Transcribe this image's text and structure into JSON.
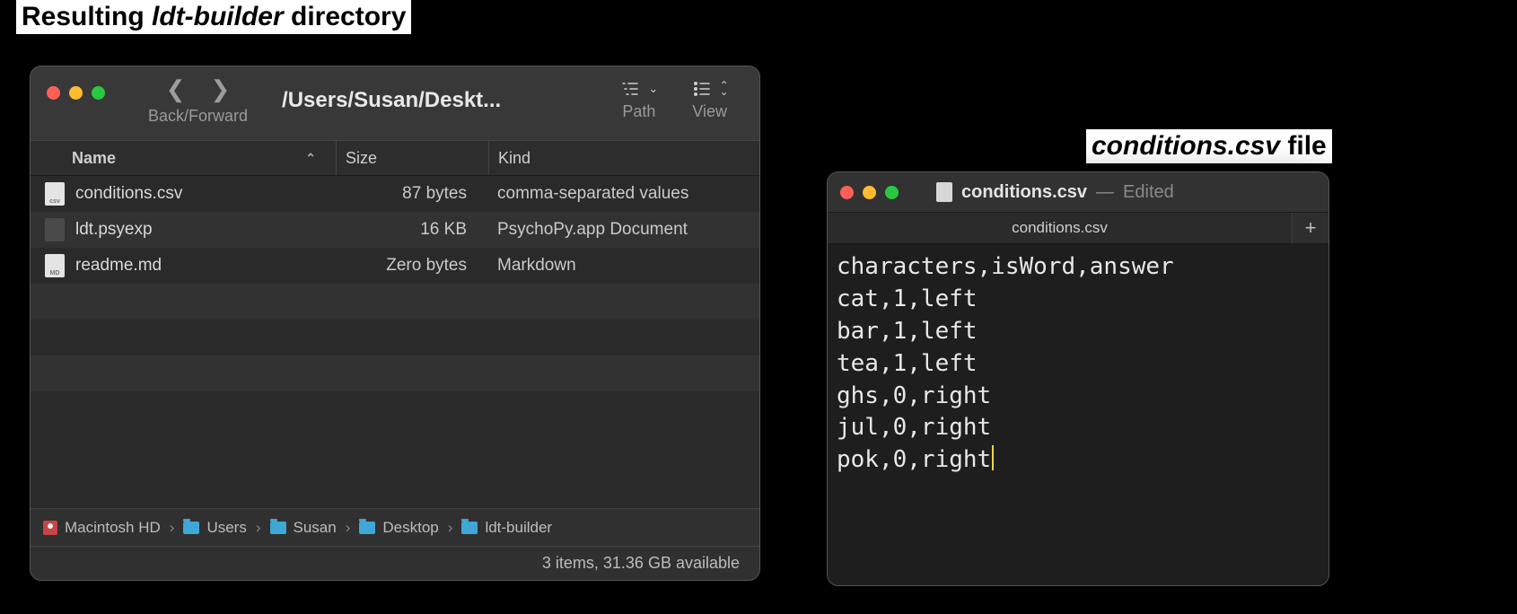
{
  "captions": {
    "left_pre": "Resulting ",
    "left_em": "ldt-builder",
    "left_post": " directory",
    "right_em": "conditions.csv",
    "right_post": " file"
  },
  "finder": {
    "navlabel": "Back/Forward",
    "title": "/Users/Susan/Deskt...",
    "toolbar": {
      "path": "Path",
      "view": "View"
    },
    "columns": {
      "name": "Name",
      "size": "Size",
      "kind": "Kind"
    },
    "rows": [
      {
        "name": "conditions.csv",
        "size": "87 bytes",
        "kind": "comma-separated values",
        "iconsub": "csv",
        "iconClass": ""
      },
      {
        "name": "ldt.psyexp",
        "size": "16 KB",
        "kind": "PsychoPy.app Document",
        "iconsub": "",
        "iconClass": "dark"
      },
      {
        "name": "readme.md",
        "size": "Zero bytes",
        "kind": "Markdown",
        "iconsub": "MD",
        "iconClass": ""
      }
    ],
    "breadcrumbs": [
      "Macintosh HD",
      "Users",
      "Susan",
      "Desktop",
      "ldt-builder"
    ],
    "status": "3 items, 31.36 GB available"
  },
  "editor": {
    "filename": "conditions.csv",
    "edited": "Edited",
    "tab": "conditions.csv",
    "lines": [
      "characters,isWord,answer",
      "cat,1,left",
      "bar,1,left",
      "tea,1,left",
      "ghs,0,right",
      "jul,0,right",
      "pok,0,right"
    ]
  }
}
